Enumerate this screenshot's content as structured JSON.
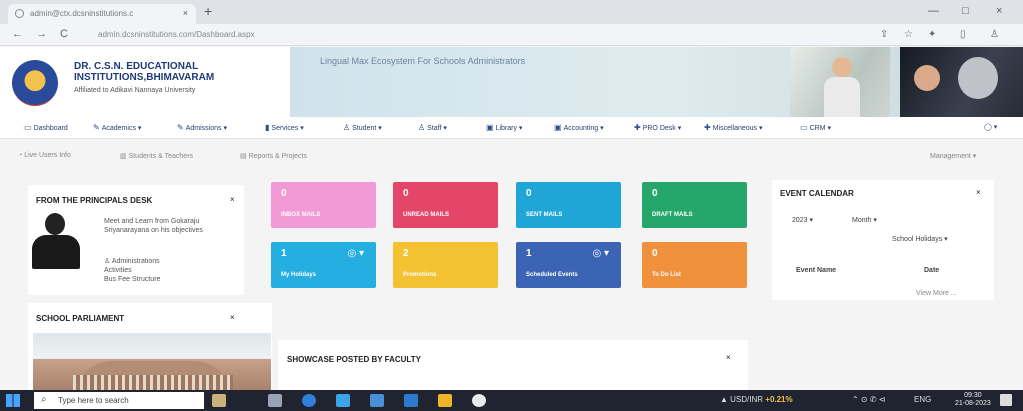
{
  "browser": {
    "tab_title": "admin@ctx.dcsninstitutions.c",
    "tab_close": "×",
    "new_tab": "+",
    "url": "admin.dcsninstitutions.com/Dashboard.aspx",
    "back": "←",
    "forward": "→",
    "reload": "C",
    "minimize": "—",
    "maximize": "□",
    "close": "×"
  },
  "header": {
    "logo_line1": "DR. C.S.N. EDUCATIONAL",
    "logo_line2": "INSTITUTIONS,BHIMAVARAM",
    "affiliation": "Affiliated to Adikavi Nannaya University",
    "banner_text": "Lingual Max Ecosystem For Schools Administrators"
  },
  "menu": [
    {
      "icon": "▭",
      "label": "Dashboard"
    },
    {
      "icon": "✎",
      "label": "Academics ▾"
    },
    {
      "icon": "✎",
      "label": "Admissions ▾"
    },
    {
      "icon": "▮",
      "label": "Services ▾"
    },
    {
      "icon": "♙",
      "label": "Student ▾"
    },
    {
      "icon": "♙",
      "label": "Staff ▾"
    },
    {
      "icon": "▣",
      "label": "Library ▾"
    },
    {
      "icon": "▣",
      "label": "Accounting ▾"
    },
    {
      "icon": "✚",
      "label": "PRO Desk ▾"
    },
    {
      "icon": "✚",
      "label": "Miscellaneous ▾"
    },
    {
      "icon": "▭",
      "label": "CRM ▾"
    }
  ],
  "crumbs": {
    "home": "Live Users Info",
    "students": "Students & Teachers",
    "reports": "Reports & Projects",
    "right": "Management ▾"
  },
  "principal": {
    "title": "FROM THE PRINCIPALS DESK",
    "close": "×",
    "desc": "Meet and Learn from Gokaraju Sriyanarayana on his objectives",
    "link1": "♙ Administrations",
    "link2": "Activities",
    "link3": "Bus Fee Structure"
  },
  "parliament": {
    "title": "SCHOOL PARLIAMENT",
    "close": "×"
  },
  "tiles": [
    {
      "num": "0",
      "label": "INBOX MAILS",
      "color": "#f29ad6",
      "icon": ""
    },
    {
      "num": "0",
      "label": "UNREAD MAILS",
      "color": "#e4466a",
      "icon": ""
    },
    {
      "num": "0",
      "label": "SENT MAILS",
      "color": "#1fa6d6",
      "icon": ""
    },
    {
      "num": "0",
      "label": "DRAFT MAILS",
      "color": "#25a76b",
      "icon": ""
    },
    {
      "num": "1",
      "label": "My Holidays",
      "color": "#25aee0",
      "icon": "◎ ▾"
    },
    {
      "num": "2",
      "label": "Promotions",
      "color": "#f2c232",
      "icon": ""
    },
    {
      "num": "1",
      "label": "Scheduled Events",
      "color": "#3c64b4",
      "icon": "◎ ▾"
    },
    {
      "num": "0",
      "label": "To Do List",
      "color": "#f0913e",
      "icon": ""
    }
  ],
  "showcase": {
    "title": "SHOWCASE POSTED BY FACULTY",
    "close": "×"
  },
  "calendar": {
    "title": "EVENT CALENDAR",
    "close": "×",
    "year": "2023 ▾",
    "month": "Month ▾",
    "type": "School Holidays ▾",
    "col_event": "Event Name",
    "col_date": "Date",
    "more": "View More ..."
  },
  "taskbar": {
    "search": "Type here to search",
    "usd": "USD/INR",
    "usd_val": "+0.21%",
    "lang": "ENG",
    "time": "09:30",
    "date": "21-08-2023",
    "tray": "⌃ ⊙ ✆ ⊲"
  }
}
